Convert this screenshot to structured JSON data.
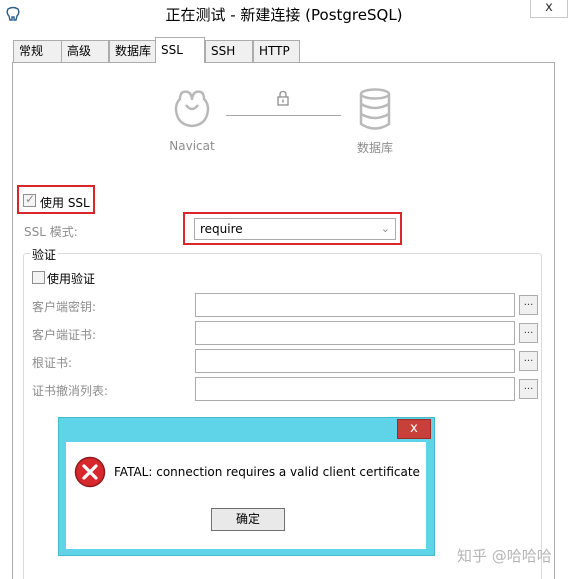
{
  "window": {
    "title": "正在测试 - 新建连接 (PostgreSQL)",
    "close_label": "x"
  },
  "tabs": [
    {
      "label": "常规",
      "active": false
    },
    {
      "label": "高级",
      "active": false
    },
    {
      "label": "数据库",
      "active": false
    },
    {
      "label": "SSL",
      "active": true
    },
    {
      "label": "SSH",
      "active": false
    },
    {
      "label": "HTTP",
      "active": false
    }
  ],
  "ssl_diagram": {
    "client_label": "Navicat",
    "server_label": "数据库",
    "icons": [
      "navicat-logo-icon",
      "lock-icon",
      "database-icon"
    ]
  },
  "ssl": {
    "use_ssl_label": "使用 SSL",
    "use_ssl_checked": true,
    "mode_label": "SSL 模式:",
    "mode_value": "require"
  },
  "auth": {
    "group_label": "验证",
    "use_auth_label": "使用验证",
    "use_auth_checked": false,
    "fields": [
      {
        "label": "客户端密钥:",
        "value": ""
      },
      {
        "label": "客户端证书:",
        "value": ""
      },
      {
        "label": "根证书:",
        "value": ""
      },
      {
        "label": "证书撤消列表:",
        "value": ""
      }
    ],
    "browse_label": "..."
  },
  "dialog": {
    "close_label": "x",
    "message": "FATAL:  connection requires a valid client certificate",
    "ok_label": "确定"
  },
  "watermark": "知乎 @哈哈哈",
  "colors": {
    "highlight": "#d9262a",
    "dialog_frame": "#5fd3e7",
    "dialog_close": "#c8403a",
    "error_icon": "#d6282d"
  }
}
